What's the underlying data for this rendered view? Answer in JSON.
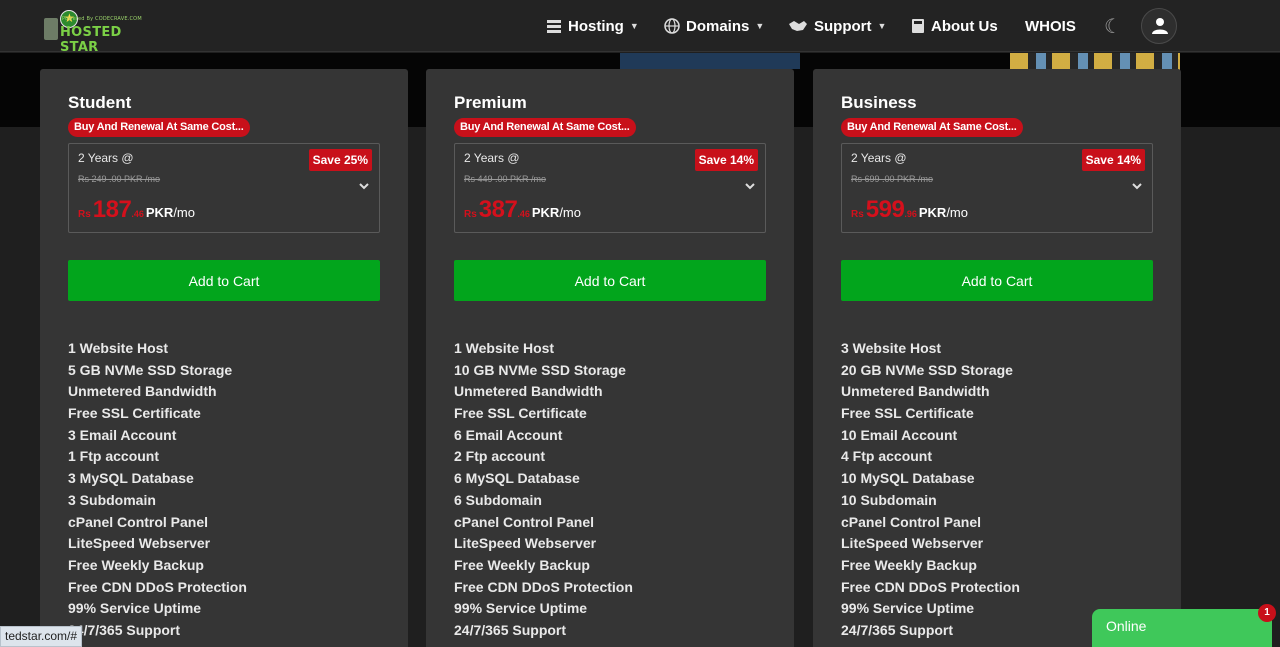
{
  "brand": {
    "tagline": "Powered By CODECRAVE.COM",
    "name": "HOSTED STAR"
  },
  "nav": [
    {
      "label": "Hosting",
      "icon": "server-icon",
      "dropdown": true
    },
    {
      "label": "Domains",
      "icon": "globe-icon",
      "dropdown": true
    },
    {
      "label": "Support",
      "icon": "handshake-icon",
      "dropdown": true
    },
    {
      "label": "About Us",
      "icon": "book-icon",
      "dropdown": false
    },
    {
      "label": "WHOIS",
      "icon": "",
      "dropdown": false
    }
  ],
  "plans": [
    {
      "name": "Student",
      "promo": "Buy And Renewal At Same Cost...",
      "term": "2 Years @",
      "save": "Save 25%",
      "old_price": "Rs 249 .00 PKR /mo",
      "currency": "Rs",
      "amount": "187",
      "decimals": ".46",
      "unit": "PKR",
      "per": "/mo",
      "cart_label": "Add to Cart",
      "features": [
        "1 Website Host",
        "5 GB NVMe SSD Storage",
        "Unmetered Bandwidth",
        "Free SSL Certificate",
        "3 Email Account",
        "1 Ftp account",
        "3 MySQL Database",
        "3 Subdomain",
        "cPanel Control Panel",
        "LiteSpeed Webserver",
        "Free Weekly Backup",
        "Free CDN DDoS Protection",
        "99% Service Uptime",
        "24/7/365 Support"
      ]
    },
    {
      "name": "Premium",
      "promo": "Buy And Renewal At Same Cost...",
      "term": "2 Years @",
      "save": "Save 14%",
      "old_price": "Rs 449 .00 PKR /mo",
      "currency": "Rs",
      "amount": "387",
      "decimals": ".46",
      "unit": "PKR",
      "per": "/mo",
      "cart_label": "Add to Cart",
      "features": [
        "1 Website Host",
        "10 GB NVMe SSD Storage",
        "Unmetered Bandwidth",
        "Free SSL Certificate",
        "6 Email Account",
        "2 Ftp account",
        "6 MySQL Database",
        "6 Subdomain",
        "cPanel Control Panel",
        "LiteSpeed Webserver",
        "Free Weekly Backup",
        "Free CDN DDoS Protection",
        "99% Service Uptime",
        "24/7/365 Support"
      ]
    },
    {
      "name": "Business",
      "promo": "Buy And Renewal At Same Cost...",
      "term": "2 Years @",
      "save": "Save 14%",
      "old_price": "Rs 699 .00 PKR /mo",
      "currency": "Rs",
      "amount": "599",
      "decimals": ".96",
      "unit": "PKR",
      "per": "/mo",
      "cart_label": "Add to Cart",
      "features": [
        "3 Website Host",
        "20 GB NVMe SSD Storage",
        "Unmetered Bandwidth",
        "Free SSL Certificate",
        "10 Email Account",
        "4 Ftp account",
        "10 MySQL Database",
        "10 Subdomain",
        "cPanel Control Panel",
        "LiteSpeed Webserver",
        "Free Weekly Backup",
        "Free CDN DDoS Protection",
        "99% Service Uptime",
        "24/7/365 Support"
      ]
    }
  ],
  "status_url": "tedstar.com/#",
  "chat": {
    "label": "Online",
    "count": "1"
  },
  "colors": {
    "accent_green": "#02a51c",
    "promo_red": "#c8101a",
    "price_red": "#d4101c",
    "card_bg": "#353535"
  }
}
